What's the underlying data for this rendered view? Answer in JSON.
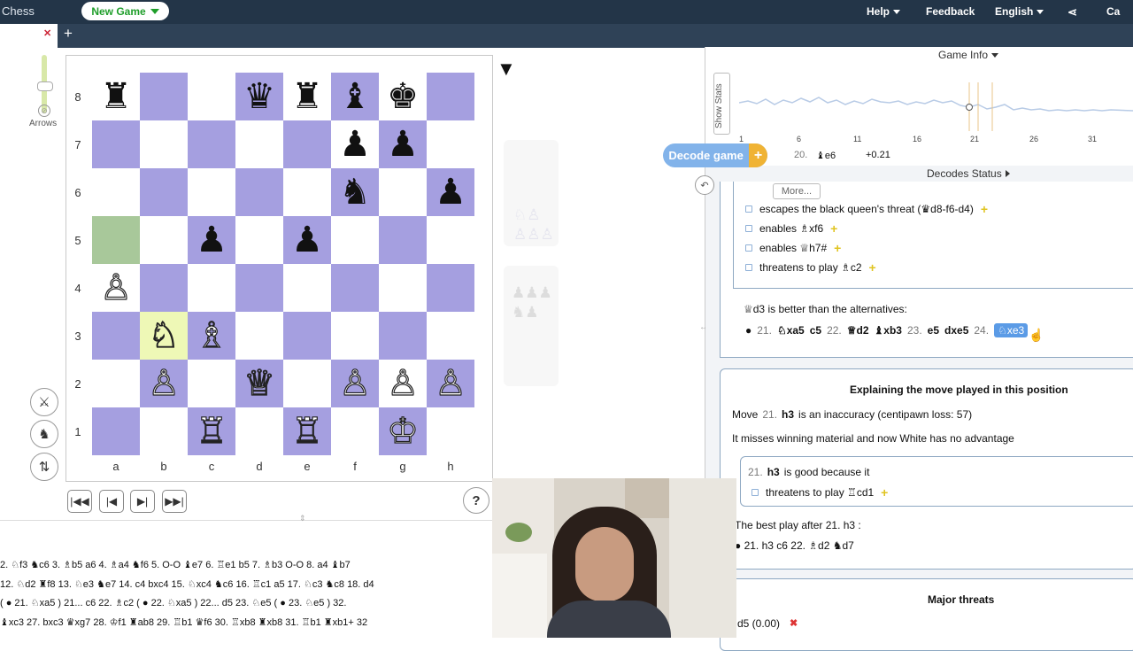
{
  "topbar": {
    "brand": "Chess",
    "new_game": "New Game",
    "help": "Help",
    "feedback": "Feedback",
    "language": "English",
    "user": "Ca"
  },
  "board": {
    "ranks": [
      "8",
      "7",
      "6",
      "5",
      "4",
      "3",
      "2",
      "1"
    ],
    "files": [
      "a",
      "b",
      "c",
      "d",
      "e",
      "f",
      "g",
      "h"
    ],
    "pieces": {
      "a8": "♜",
      "d8": "♛",
      "e8": "♜",
      "f8": "♝",
      "g8": "♚",
      "f7": "♟",
      "g7": "♟",
      "f6": "♞",
      "h6": "♟",
      "c5": "♟",
      "e5": "♟",
      "a4": "♙",
      "b3": "♘",
      "c3": "♗",
      "b2": "♙",
      "d2": "♕",
      "f2": "♙",
      "g2": "♙",
      "h2": "♙",
      "c1": "♖",
      "e1": "♖",
      "g1": "♔"
    },
    "highlight_from": "a5",
    "highlight_to": "b3",
    "arrows_label": "Arrows",
    "captured_top": "♘♙\n♙♙♙",
    "captured_bottom": "♟♟♟\n♞♟"
  },
  "moves": {
    "lines": [
      "2. ♘f3   ♞c6  3. ♗b5   a6  4. ♗a4   ♞f6  5. O-O   ♝e7  6. ♖e1   b5  7. ♗b3   O-O  8. a4   ♝b7",
      "12. ♘d2   ♜f8  13. ♘e3   ♞e7  14. c4   bxc4  15. ♘xc4   ♞c6  16. ♖c1   a5  17. ♘c3   ♞c8  18. d4",
      "( ● 21. ♘xa5 ) 21... c6  22. ♗c2  ( ● 22. ♘xa5 ) 22... d5  23. ♘e5  ( ● 23. ♘e5 )  32.",
      "♝xc3  27. bxc3   ♛xg7  28. ♔f1   ♜ab8  29. ♖b1   ♛f6  30. ♖xb8   ♜xb8  31. ♖b1   ♜xb1+  32"
    ]
  },
  "panel": {
    "game_info": "Game Info",
    "show_stats": "Show Stats",
    "x_ticks": [
      "1",
      "6",
      "11",
      "16",
      "21",
      "26",
      "31"
    ],
    "decode_game": "Decode game",
    "decode_plus": "+",
    "eval_move": "20.",
    "eval_piece": "♝e6",
    "eval_value": "+0.21",
    "decodes_status": "Decodes Status",
    "more": "More...",
    "bullets": [
      "escapes the black queen's threat (♛d8-f6-d4)",
      "enables ♗xf6",
      "enables ♕h7#",
      "threatens to play ♗c2"
    ],
    "better_than": "♕d3  is better than the alternatives:",
    "alt_line": {
      "n1": "21.",
      "m1": "♘xa5",
      "m2": "c5",
      "n2": "22.",
      "m3": "♕d2",
      "m4": "♝xb3",
      "n3": "23.",
      "m5": "e5",
      "m6": "dxe5",
      "n4": "24.",
      "m7": "♘xe3"
    },
    "explain_title": "Explaining the move played in this position",
    "move_line_pre": "Move",
    "move_line_num": "21.",
    "move_line_move": "h3",
    "move_line_post": "is an inaccuracy (centipawn loss: 57)",
    "misses": "It misses winning material and now White has no advantage",
    "good_num": "21.",
    "good_move": "h3",
    "good_post": "is good because it",
    "good_bullet": "threatens to play ♖cd1",
    "best_play": "The best play after 21.  h3 :",
    "best_line": "● 21.  h3   c6  22.  ♗d2   ♞d7",
    "major_threats": "Major threats",
    "threat_line": "d5 (0.00)",
    "threat_x": "✖"
  }
}
